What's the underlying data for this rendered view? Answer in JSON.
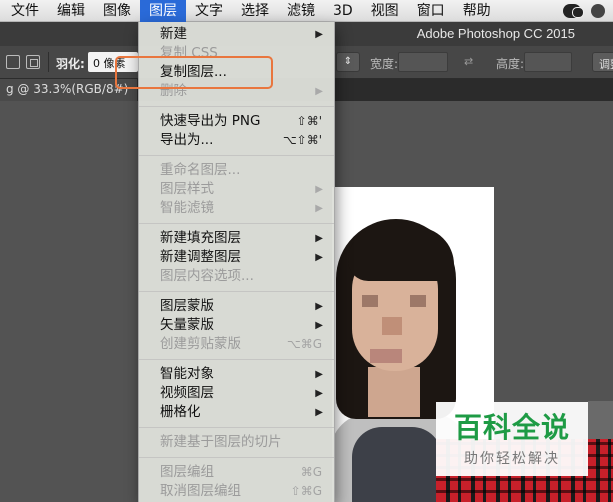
{
  "menubar": {
    "items": [
      "文件",
      "编辑",
      "图像",
      "图层",
      "文字",
      "选择",
      "滤镜",
      "3D",
      "视图",
      "窗口",
      "帮助"
    ],
    "active": "图层"
  },
  "titlebar": {
    "app_title": "Adobe Photoshop CC 2015"
  },
  "options_bar": {
    "feather_label": "羽化:",
    "feather_value": "0 像素",
    "width_label": "宽度:",
    "swap_glyph": "⇄",
    "height_label": "高度:",
    "refine_label": "调整边缘"
  },
  "document": {
    "tab_title": "g @ 33.3%(RGB/8#)"
  },
  "layer_menu": {
    "groups": [
      [
        {
          "label": "新建",
          "shortcut": "",
          "submenu": true,
          "enabled": true
        },
        {
          "label": "复制 CSS",
          "shortcut": "",
          "submenu": false,
          "enabled": false
        },
        {
          "label": "复制图层...",
          "shortcut": "",
          "submenu": false,
          "enabled": true
        },
        {
          "label": "删除",
          "shortcut": "",
          "submenu": true,
          "enabled": false
        }
      ],
      [
        {
          "label": "快速导出为 PNG",
          "shortcut": "⇧⌘'",
          "submenu": false,
          "enabled": true
        },
        {
          "label": "导出为...",
          "shortcut": "⌥⇧⌘'",
          "submenu": false,
          "enabled": true
        }
      ],
      [
        {
          "label": "重命名图层...",
          "shortcut": "",
          "submenu": false,
          "enabled": false
        },
        {
          "label": "图层样式",
          "shortcut": "",
          "submenu": true,
          "enabled": false
        },
        {
          "label": "智能滤镜",
          "shortcut": "",
          "submenu": true,
          "enabled": false
        }
      ],
      [
        {
          "label": "新建填充图层",
          "shortcut": "",
          "submenu": true,
          "enabled": true
        },
        {
          "label": "新建调整图层",
          "shortcut": "",
          "submenu": true,
          "enabled": true
        },
        {
          "label": "图层内容选项...",
          "shortcut": "",
          "submenu": false,
          "enabled": false
        }
      ],
      [
        {
          "label": "图层蒙版",
          "shortcut": "",
          "submenu": true,
          "enabled": true
        },
        {
          "label": "矢量蒙版",
          "shortcut": "",
          "submenu": true,
          "enabled": true
        },
        {
          "label": "创建剪贴蒙版",
          "shortcut": "⌥⌘G",
          "submenu": false,
          "enabled": false
        }
      ],
      [
        {
          "label": "智能对象",
          "shortcut": "",
          "submenu": true,
          "enabled": true
        },
        {
          "label": "视频图层",
          "shortcut": "",
          "submenu": true,
          "enabled": true
        },
        {
          "label": "栅格化",
          "shortcut": "",
          "submenu": true,
          "enabled": true
        }
      ],
      [
        {
          "label": "新建基于图层的切片",
          "shortcut": "",
          "submenu": false,
          "enabled": false
        }
      ],
      [
        {
          "label": "图层编组",
          "shortcut": "⌘G",
          "submenu": false,
          "enabled": false
        },
        {
          "label": "取消图层编组",
          "shortcut": "⇧⌘G",
          "submenu": false,
          "enabled": false
        }
      ]
    ],
    "highlighted_item": "复制图层...",
    "arrow_glyph": "▶"
  },
  "watermark": {
    "title": "百科全说",
    "subtitle": "助你轻松解决"
  },
  "colors": {
    "menubar_active": "#2a6ad8",
    "highlight_annotation": "#e9763e",
    "watermark_green": "#1e9b45"
  }
}
